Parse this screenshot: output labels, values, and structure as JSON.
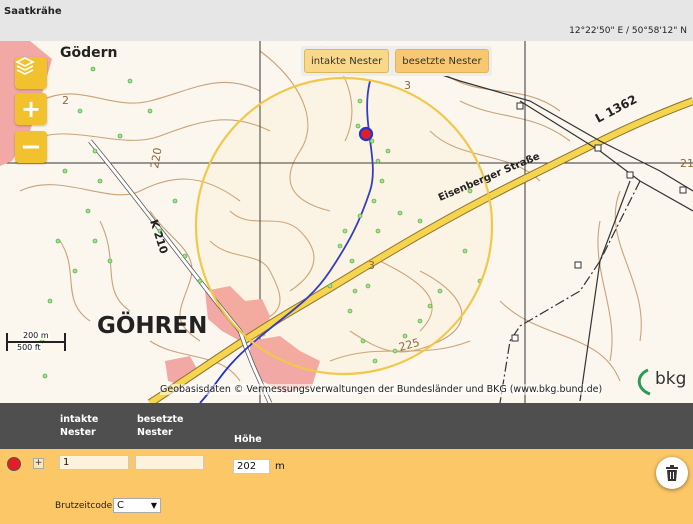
{
  "window": {
    "title": "Saatkrähe"
  },
  "map": {
    "coordinate_readout": "12°22'50\" E / 50°58'12\" N",
    "toggles": [
      "intakte Nester",
      "besetzte Nester"
    ],
    "scale": {
      "metric": "200 m",
      "imperial": "500 ft"
    },
    "attribution": "Geobasisdaten © Vermessungsverwaltungen der Bundesländer und BKG (www.bkg.bund.de)",
    "logo_text": "bkg",
    "labels": {
      "village_godern": "Gödern",
      "village_gohren": "GÖHREN",
      "road_k210": "K 210",
      "road_l1362": "L 1362",
      "street_eisenberger": "Eisenberger Straße",
      "elev_220": "220",
      "elev_225": "225",
      "elev_3a": "3",
      "elev_3b": "3",
      "elev_2": "2",
      "elev_21": "21"
    },
    "colors": {
      "marker": "#e41e25",
      "circle": "#f2c84b",
      "control": "#f2c12e"
    }
  },
  "table": {
    "headers": {
      "intakte": [
        "intakte",
        "Nester"
      ],
      "besetzte": [
        "besetzte",
        "Nester"
      ],
      "hoehe": "Höhe"
    },
    "row": {
      "intakte_value": "1",
      "besetzte_value": "",
      "hoehe_value": "202",
      "hoehe_unit": "m",
      "brutzeitcode_label": "Brutzeitcode",
      "brutzeitcode_value": "C"
    }
  }
}
